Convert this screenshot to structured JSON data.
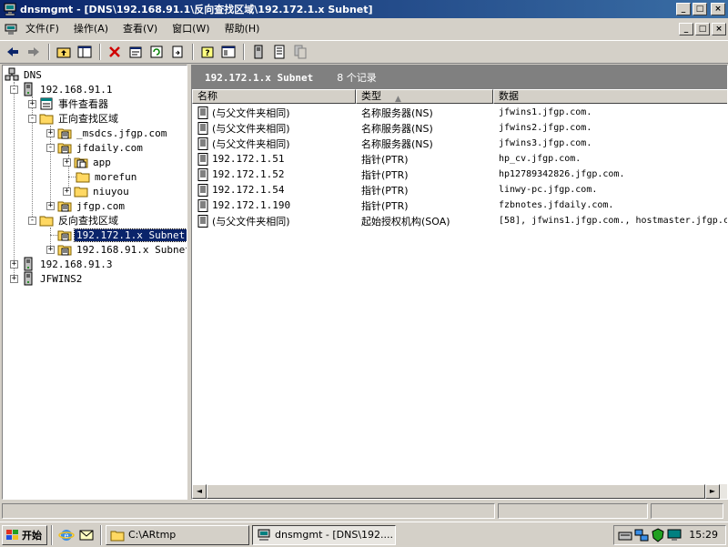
{
  "window": {
    "title": "dnsmgmt - [DNS\\192.168.91.1\\反向查找区域\\192.172.1.x Subnet]",
    "minimize": "_",
    "maximize": "□",
    "close": "×"
  },
  "menu": {
    "items": [
      "文件(F)",
      "操作(A)",
      "查看(V)",
      "窗口(W)",
      "帮助(H)"
    ]
  },
  "toolbar": {
    "buttons": [
      "back-icon",
      "forward-icon",
      "up-folder-icon",
      "show-hide-tree-icon",
      "delete-icon",
      "properties-icon",
      "refresh-icon",
      "export-icon",
      "help-icon",
      "console-icon",
      "record-icon",
      "server-icon",
      "copy-icon"
    ]
  },
  "tree": {
    "nodes": [
      {
        "label": "DNS",
        "expander": "",
        "icon": "dns"
      },
      {
        "label": "192.168.91.1",
        "expander": "-",
        "icon": "server"
      },
      {
        "label": "事件查看器",
        "expander": "+",
        "icon": "eventlog"
      },
      {
        "label": "正向查找区域",
        "expander": "-",
        "icon": "folder"
      },
      {
        "label": "_msdcs.jfgp.com",
        "expander": "+",
        "icon": "zone"
      },
      {
        "label": "jfdaily.com",
        "expander": "-",
        "icon": "zone"
      },
      {
        "label": "app",
        "expander": "+",
        "icon": "zone-folder"
      },
      {
        "label": "morefun",
        "expander": "",
        "icon": "folder"
      },
      {
        "label": "niuyou",
        "expander": "+",
        "icon": "folder"
      },
      {
        "label": "jfgp.com",
        "expander": "+",
        "icon": "zone"
      },
      {
        "label": "反向查找区域",
        "expander": "-",
        "icon": "folder"
      },
      {
        "label": "192.172.1.x Subnet",
        "expander": "",
        "icon": "zone",
        "selected": true
      },
      {
        "label": "192.168.91.x Subnet",
        "expander": "+",
        "icon": "zone"
      },
      {
        "label": "192.168.91.3",
        "expander": "+",
        "icon": "server"
      },
      {
        "label": "JFWINS2",
        "expander": "+",
        "icon": "server"
      }
    ]
  },
  "details": {
    "zone_name": "192.172.1.x Subnet",
    "record_count": "8 个记录",
    "columns": [
      "名称",
      "类型",
      "数据"
    ],
    "sort_indicator": "▲",
    "rows": [
      {
        "name": "(与父文件夹相同)",
        "type": "名称服务器(NS)",
        "data": "jfwins1.jfgp.com."
      },
      {
        "name": "(与父文件夹相同)",
        "type": "名称服务器(NS)",
        "data": "jfwins2.jfgp.com."
      },
      {
        "name": "(与父文件夹相同)",
        "type": "名称服务器(NS)",
        "data": "jfwins3.jfgp.com."
      },
      {
        "name": "192.172.1.51",
        "type": "指针(PTR)",
        "data": "hp_cv.jfgp.com."
      },
      {
        "name": "192.172.1.52",
        "type": "指针(PTR)",
        "data": "hp12789342826.jfgp.com."
      },
      {
        "name": "192.172.1.54",
        "type": "指针(PTR)",
        "data": "linwy-pc.jfgp.com."
      },
      {
        "name": "192.172.1.190",
        "type": "指针(PTR)",
        "data": "fzbnotes.jfdaily.com."
      },
      {
        "name": "(与父文件夹相同)",
        "type": "起始授权机构(SOA)",
        "data": "[58], jfwins1.jfgp.com., hostmaster.jfgp.c"
      }
    ]
  },
  "scrollbar": {
    "left": "◄",
    "right": "►"
  },
  "taskbar": {
    "start_label": "开始",
    "tasks": [
      {
        "label": "C:\\ARtmp",
        "active": false
      },
      {
        "label": "dnsmgmt - [DNS\\192....",
        "active": true
      }
    ],
    "clock": "15:29"
  },
  "colors": {
    "title_start": "#0a246a",
    "title_end": "#3a6ea5",
    "face": "#d4d0c8",
    "selection": "#0a246a",
    "pane_header": "#808080"
  }
}
